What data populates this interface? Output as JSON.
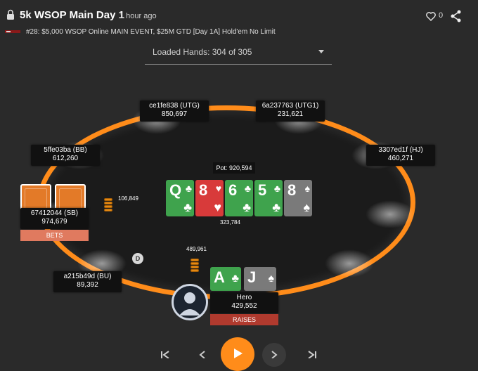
{
  "header": {
    "title": "5k WSOP Main Day 1",
    "time_ago": "1 hour ago",
    "like_count": "0",
    "subtitle": "#28: $5,000 WSOP Online MAIN EVENT, $25M GTD [Day 1A] Hold'em No Limit"
  },
  "hands_dropdown": {
    "label": "Loaded Hands: 304 of 305"
  },
  "players": {
    "utg": {
      "name": "ce1fe838 (UTG)",
      "stack": "850,697"
    },
    "utg1": {
      "name": "6a237763 (UTG1)",
      "stack": "231,621"
    },
    "bb": {
      "name": "5ffe03ba (BB)",
      "stack": "612,260"
    },
    "hj": {
      "name": "3307ed1f (HJ)",
      "stack": "460,271"
    },
    "sb": {
      "name": "67412044 (SB)",
      "stack": "974,679",
      "action": "BETS",
      "bet": "106,849"
    },
    "bu": {
      "name": "a215b49d (BU)",
      "stack": "89,392"
    },
    "hero": {
      "name": "Hero",
      "stack": "429,552",
      "action": "RAISES",
      "bet": "489,961"
    }
  },
  "pot": "Pot: 920,594",
  "board_bet_text": "323,784",
  "board": [
    {
      "rank": "Q",
      "suit": "♣",
      "color": "green"
    },
    {
      "rank": "8",
      "suit": "♥",
      "color": "red"
    },
    {
      "rank": "6",
      "suit": "♣",
      "color": "green"
    },
    {
      "rank": "5",
      "suit": "♣",
      "color": "green"
    },
    {
      "rank": "8",
      "suit": "♠",
      "color": "gray"
    }
  ],
  "hero_cards": [
    {
      "rank": "A",
      "suit": "♣",
      "color": "green"
    },
    {
      "rank": "J",
      "suit": "♠",
      "color": "gray"
    }
  ],
  "dealer_button": "D",
  "colors": {
    "accent": "#ff8c1a",
    "bets_bg": "#e07a5f",
    "raises_bg": "#b03a2e",
    "club_green": "#3fa34d",
    "heart_red": "#d83a3a",
    "spade_gray": "#7a7a7a"
  },
  "icons": [
    "lock-icon",
    "heart-outline-icon",
    "share-icon",
    "first-icon",
    "prev-icon",
    "play-icon",
    "next-icon",
    "last-icon"
  ]
}
